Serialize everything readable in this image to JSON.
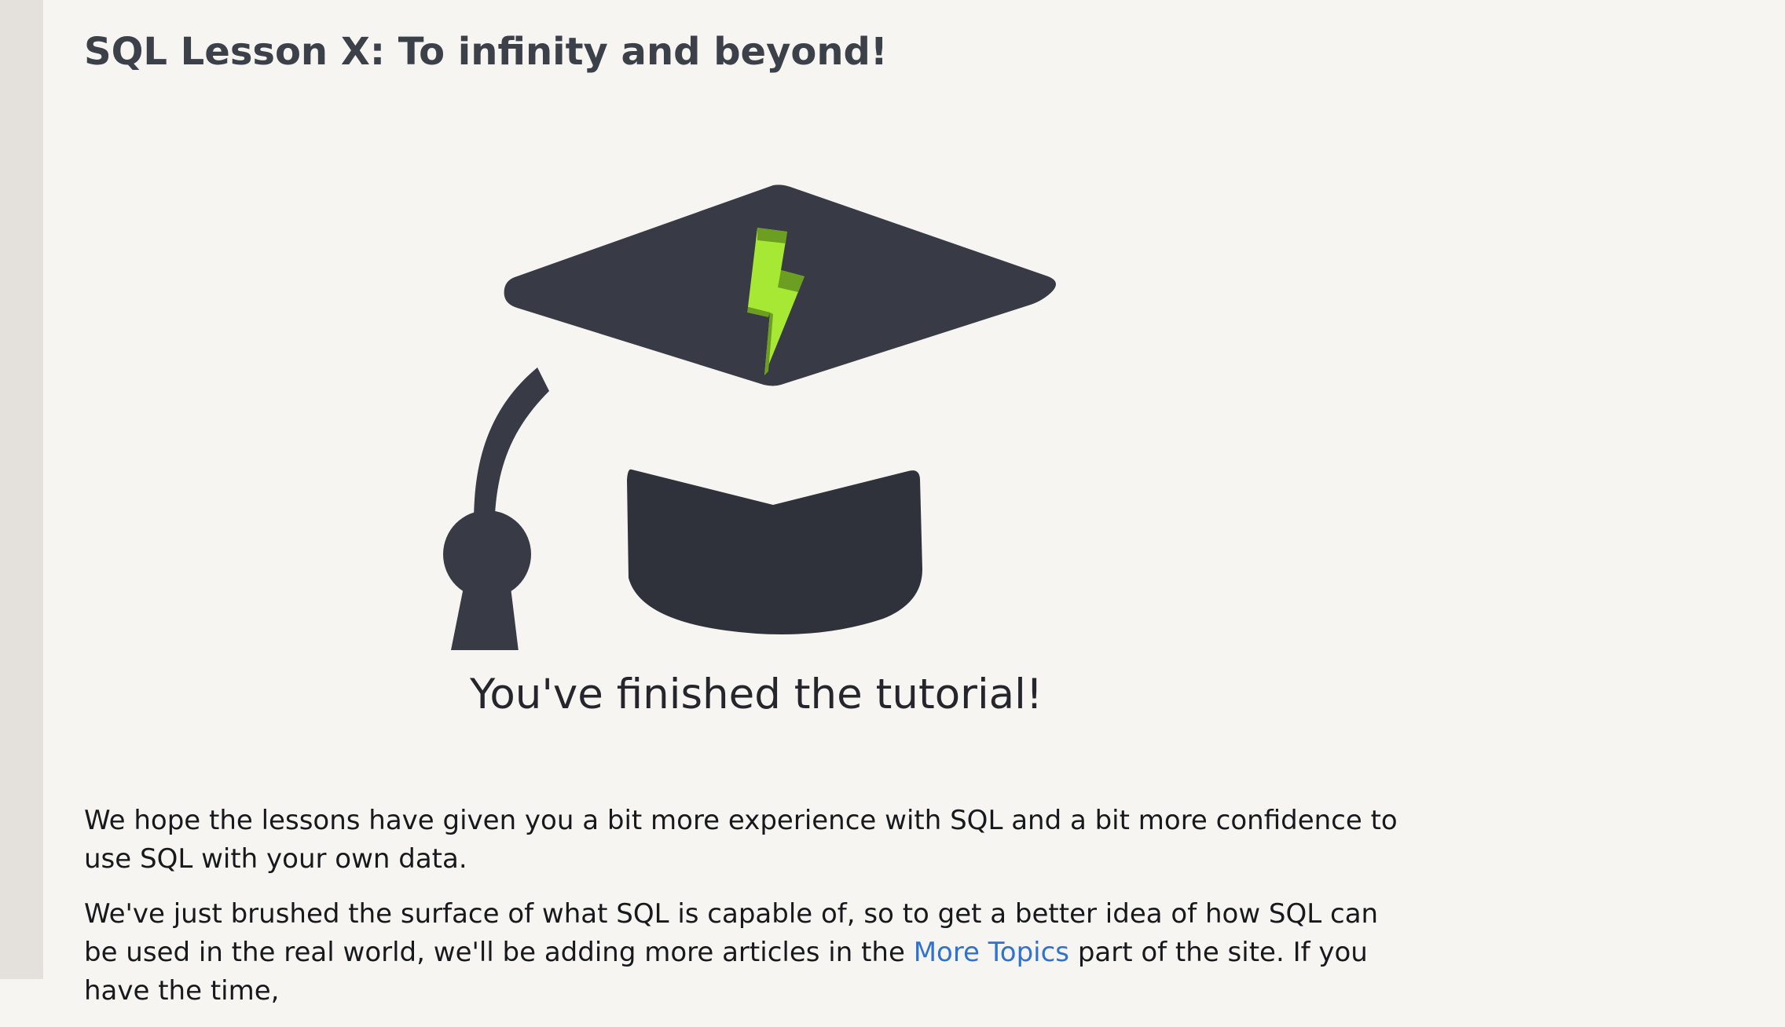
{
  "lesson": {
    "title": "SQL Lesson X: To infinity and beyond!"
  },
  "hero": {
    "icon": "graduation-cap-icon",
    "bolt_icon": "lightning-bolt-icon",
    "caption": "You've finished the tutorial!"
  },
  "body": {
    "paragraph_1": "We hope the lessons have given you a bit more experience with SQL and a bit more confidence to use SQL with your own data.",
    "paragraph_2_before_link": "We've just brushed the surface of what SQL is capable of, so to get a better idea of how SQL can be used in the real world, we'll be adding more articles in the ",
    "paragraph_2_link": "More Topics",
    "paragraph_2_after_link": " part of the site. If you have the time,"
  },
  "colors": {
    "page_background": "#f6f5f1",
    "left_rail": "#e4e0dc",
    "cap_dark": "#383b45",
    "cap_shadow": "#30323b",
    "bolt_light": "#a6e833",
    "bolt_dark": "#6c9e22",
    "link": "#2f73cf"
  }
}
